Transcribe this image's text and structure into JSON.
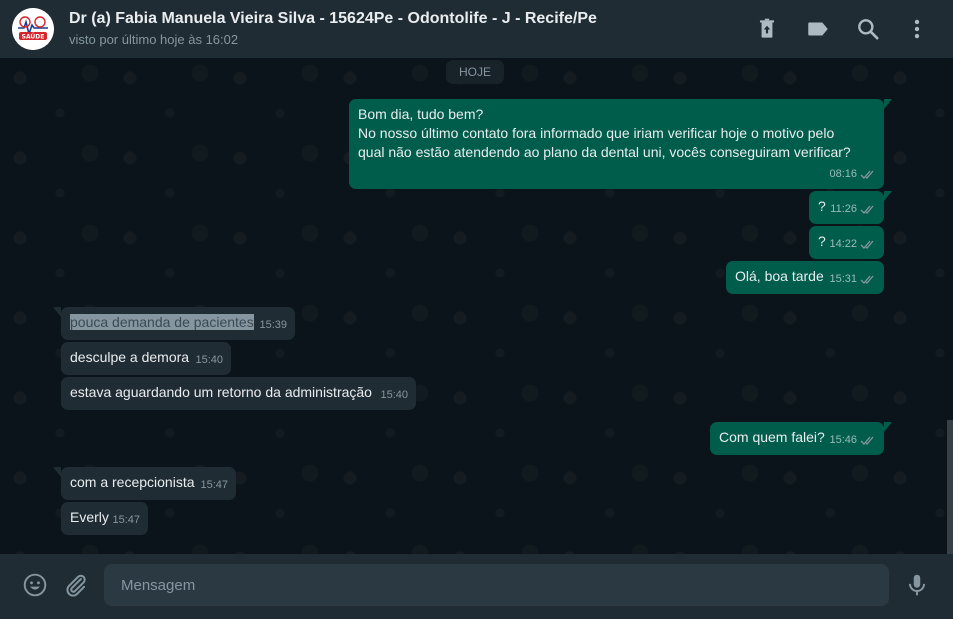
{
  "header": {
    "title": "Dr (a) Fabia Manuela Vieira Silva - 15624Pe - Odontolife - J - Recife/Pe",
    "subtitle": "visto por último hoje às 16:02",
    "avatar_text": "SAÚDE",
    "icons": [
      "delete-icon",
      "label-icon",
      "search-icon",
      "menu-icon"
    ]
  },
  "chat": {
    "date_divider": "HOJE",
    "messages": [
      {
        "direction": "out",
        "text": "Bom dia, tudo bem?\nNo nosso último contato fora informado que iriam verificar hoje o motivo pelo\nqual não estão atendendo ao plano da dental uni, vocês conseguiram verificar?",
        "time": "08:16",
        "status": "read"
      },
      {
        "direction": "out",
        "text": "?",
        "time": "11:26",
        "status": "read"
      },
      {
        "direction": "out",
        "text": "?",
        "time": "14:22",
        "status": "read"
      },
      {
        "direction": "out",
        "text": "Olá, boa tarde",
        "time": "15:31",
        "status": "read"
      },
      {
        "direction": "in",
        "text": "pouca demanda de pacientes",
        "time": "15:39"
      },
      {
        "direction": "in",
        "text": "desculpe a demora",
        "time": "15:40"
      },
      {
        "direction": "in",
        "text": "estava aguardando um retorno da administração",
        "time": "15:40"
      },
      {
        "direction": "out",
        "text": "Com quem falei?",
        "time": "15:46",
        "status": "read"
      },
      {
        "direction": "in",
        "text": "com a recepcionista",
        "time": "15:47"
      },
      {
        "direction": "in",
        "text": "Everly",
        "time": "15:47"
      }
    ]
  },
  "footer": {
    "placeholder": "Mensagem",
    "icons": [
      "emoji-icon",
      "attach-icon",
      "mic-icon"
    ]
  },
  "colors": {
    "outgoing_bubble": "#005c4b",
    "incoming_bubble": "#202c33",
    "header_bg": "#202c33",
    "chat_bg": "#0b141a",
    "read_ticks": "#8696a0"
  }
}
